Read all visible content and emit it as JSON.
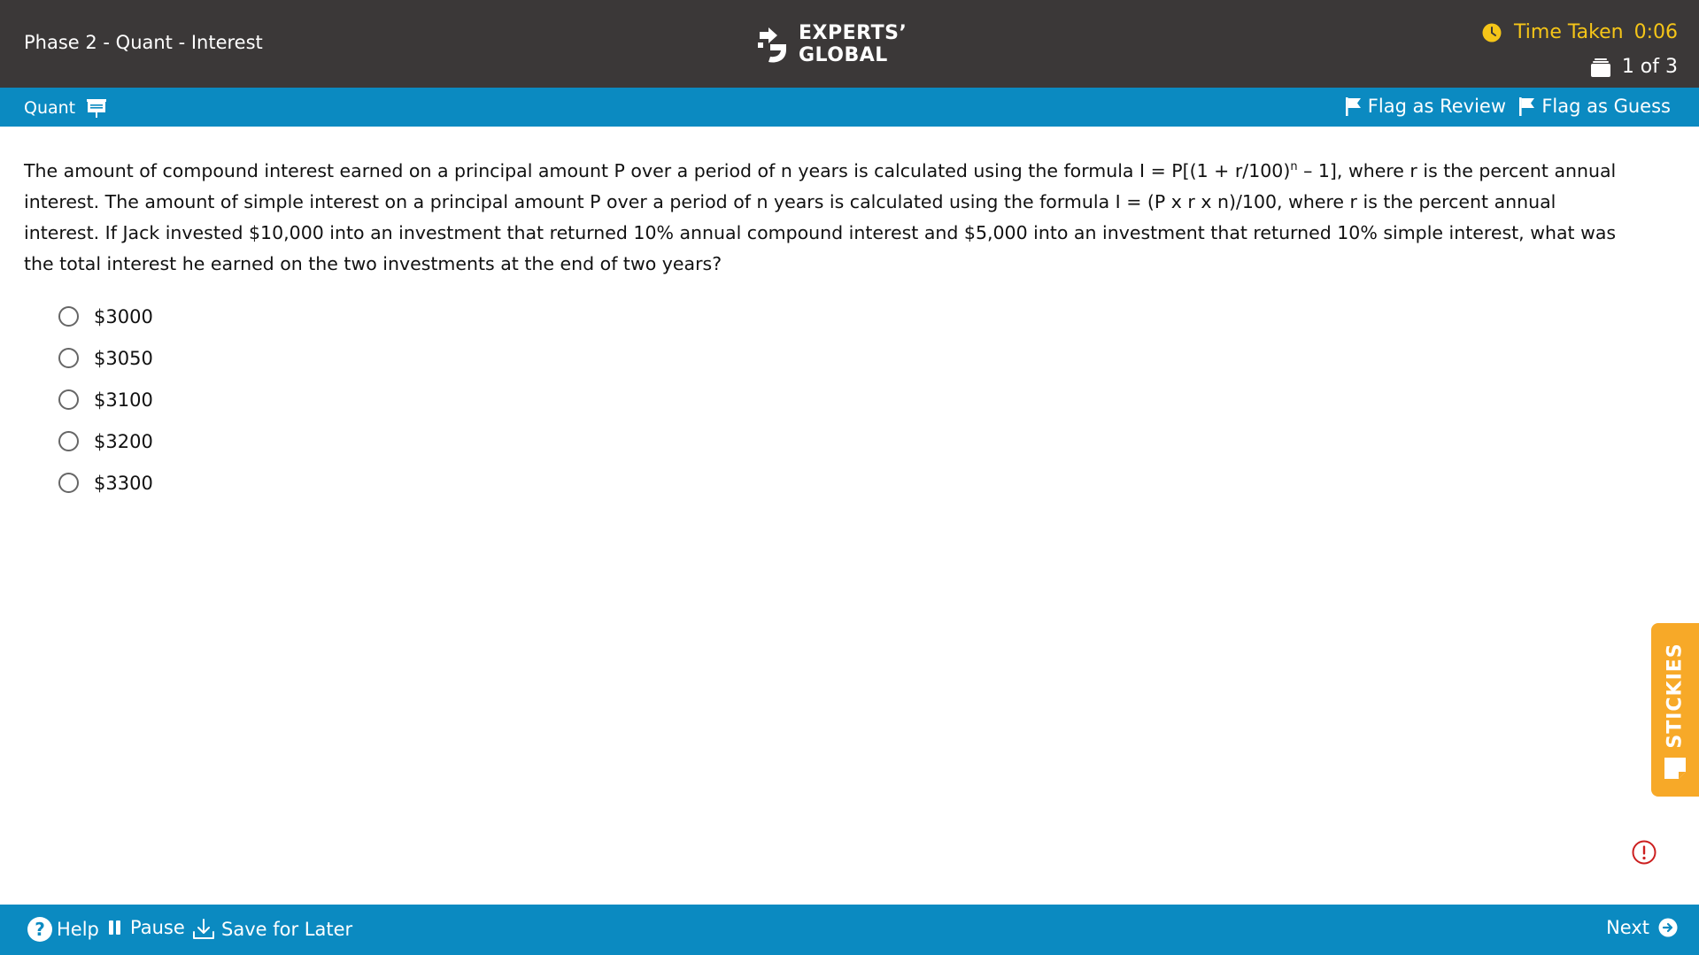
{
  "header": {
    "section_title": "Phase 2 - Quant - Interest",
    "logo_line1": "EXPERTS’",
    "logo_line2": "GLOBAL",
    "time_label": "Time Taken",
    "time_value": "0:06",
    "progress": "1 of 3"
  },
  "toolbar": {
    "section_label": "Quant",
    "flag_review": "Flag as Review",
    "flag_guess": "Flag as Guess"
  },
  "question": {
    "part1": "The amount of compound interest earned on a principal amount P over a period of n years is calculated using the formula I = P[(1 + r/100)",
    "exponent": "n",
    "part2": " – 1], where r is the percent annual interest. The amount of simple interest on a principal amount P over a period of n years is calculated using the formula I = (P x r x n)/100, where r is the percent annual interest. If Jack invested $10,000 into an investment that returned 10% annual compound interest and $5,000 into an investment that returned 10% simple interest, what was the total interest he earned on the two investments at the end of two years?",
    "options": [
      "$3000",
      "$3050",
      "$3100",
      "$3200",
      "$3300"
    ]
  },
  "stickies": {
    "label": "STICKIES"
  },
  "footer": {
    "help": "Help",
    "pause": "Pause",
    "save": "Save for Later",
    "next": "Next"
  },
  "colors": {
    "header_bg": "#3b3838",
    "toolbar_bg": "#0b8ac1",
    "timer_accent": "#f5c518",
    "stickies_bg": "#f7a928",
    "alert": "#cc1f1f"
  },
  "icons": {
    "clock": "clock-icon",
    "progress": "question-stack-icon",
    "section": "presentation-board-icon",
    "flag": "flag-icon",
    "stickies": "sticky-note-icon",
    "alert": "alert-circle-icon",
    "help": "help-circle-icon",
    "pause": "pause-icon",
    "save": "download-icon",
    "next": "arrow-right-circle-icon"
  }
}
